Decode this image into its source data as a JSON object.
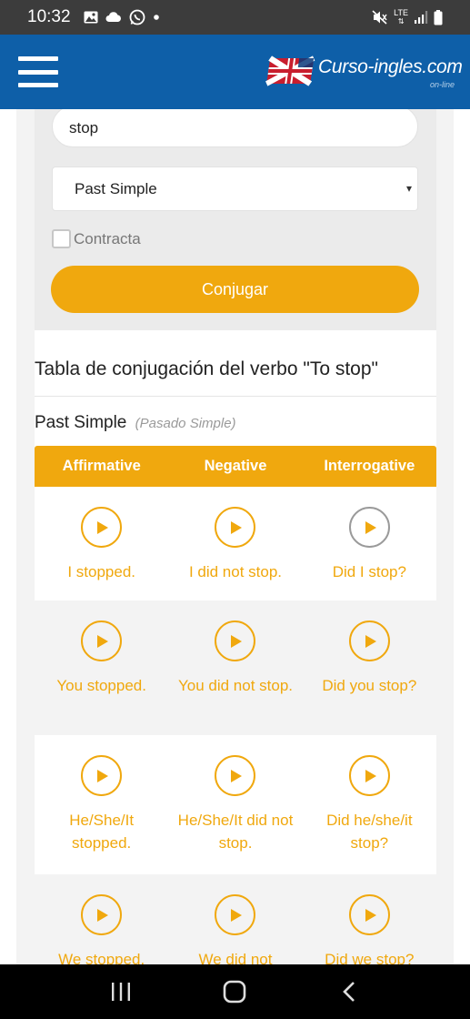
{
  "status_bar": {
    "time": "10:32",
    "left_icons": [
      "image-icon",
      "cloud-icon",
      "whatsapp-icon",
      "dot-icon"
    ],
    "right_icons": [
      "mute-icon",
      "lte-icon",
      "signal-icon",
      "battery-icon"
    ],
    "lte_label": "LTE"
  },
  "header": {
    "logo_text": "Curso-ingles.com",
    "logo_sub": "on-line"
  },
  "form": {
    "verb_value": "stop",
    "tense_selected": "Past Simple",
    "select_arrow": "▾",
    "contract_label": "Contracta",
    "contract_checked": false,
    "submit_label": "Conjugar"
  },
  "results": {
    "title": "Tabla de conjugación del verbo \"To stop\"",
    "tense_name": "Past Simple",
    "tense_translation": "(Pasado Simple)",
    "columns": [
      "Affirmative",
      "Negative",
      "Interrogative"
    ],
    "rows": [
      [
        "I stopped.",
        "I did not stop.",
        "Did I stop?"
      ],
      [
        "You stopped.",
        "You did not stop.",
        "Did you stop?"
      ],
      [
        "He/She/It stopped.",
        "He/She/It did not stop.",
        "Did he/she/it stop?"
      ],
      [
        "We stopped.",
        "We did not",
        "Did we stop?"
      ]
    ]
  },
  "colors": {
    "brand_blue": "#0e5fa8",
    "accent_orange": "#f0a80e",
    "status_bar": "#3c3c3c"
  },
  "nav_bar": {
    "icons": [
      "recent-apps-icon",
      "home-icon",
      "back-icon"
    ]
  }
}
